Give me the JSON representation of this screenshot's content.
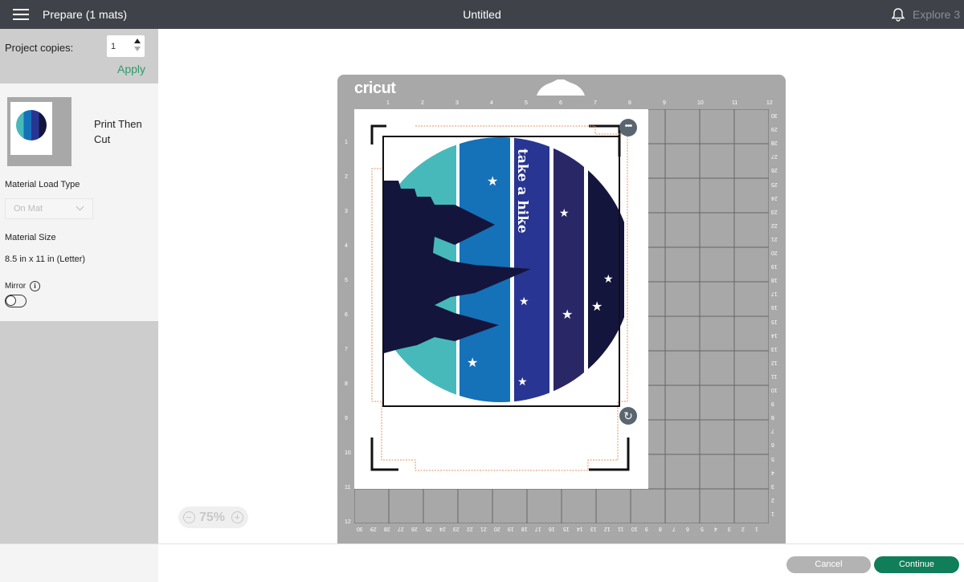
{
  "header": {
    "menu_icon": "hamburger-menu-icon",
    "title": "Prepare (1 mats)",
    "document_title": "Untitled",
    "notification_icon": "bell-icon",
    "machine": "Explore 3"
  },
  "sidebar": {
    "project_copies_label": "Project copies:",
    "project_copies_value": "1",
    "apply_label": "Apply",
    "mat_mode": "Print Then Cut",
    "material_load_type_label": "Material Load Type",
    "material_load_type_value": "On Mat",
    "material_size_label": "Material Size",
    "material_size_value": "8.5 in x 11 in (Letter)",
    "mirror_label": "Mirror",
    "mirror_on": false
  },
  "canvas": {
    "zoom_level": "75%",
    "mat_brand": "cricut",
    "top_ruler": [
      "1",
      "2",
      "3",
      "4",
      "5",
      "6",
      "7",
      "8",
      "9",
      "10",
      "11",
      "12"
    ],
    "left_ruler": [
      "1",
      "2",
      "3",
      "4",
      "5",
      "6",
      "7",
      "8",
      "9",
      "10",
      "11",
      "12"
    ],
    "right_ruler": [
      "30",
      "29",
      "28",
      "27",
      "26",
      "25",
      "24",
      "23",
      "22",
      "21",
      "20",
      "19",
      "18",
      "17",
      "16",
      "15",
      "14",
      "13",
      "12",
      "11",
      "10",
      "9",
      "8",
      "7",
      "6",
      "5",
      "4",
      "3",
      "2",
      "1"
    ],
    "bottom_ruler": [
      "30",
      "29",
      "28",
      "27",
      "26",
      "25",
      "24",
      "23",
      "22",
      "21",
      "20",
      "19",
      "18",
      "17",
      "16",
      "15",
      "14",
      "13",
      "12",
      "11",
      "10",
      "9",
      "8",
      "7",
      "6",
      "5",
      "4",
      "3",
      "2",
      "1"
    ],
    "design_text": "take a hike",
    "colors": {
      "teal": "#47b9bb",
      "blue": "#1571b8",
      "indigo": "#283593",
      "violet": "#2a2766",
      "navy": "#13153d"
    }
  },
  "footer": {
    "cancel_label": "Cancel",
    "continue_label": "Continue",
    "accent": "#107e58"
  }
}
